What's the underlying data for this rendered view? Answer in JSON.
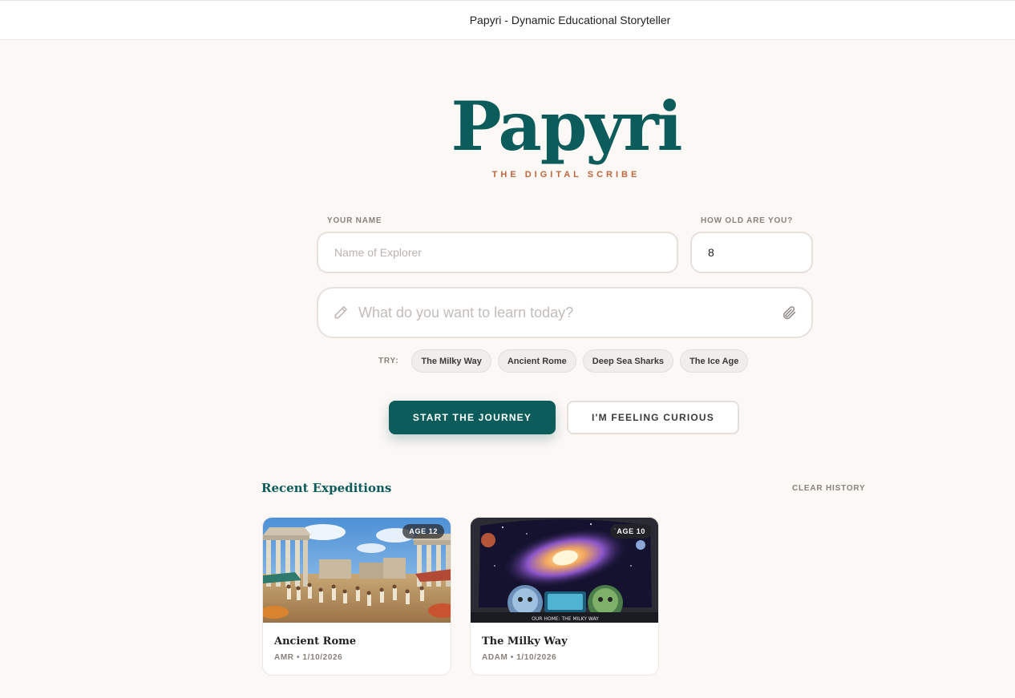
{
  "window": {
    "title": "Papyri - Dynamic Educational Storyteller"
  },
  "brand": {
    "name": "Papyri",
    "tagline": "THE DIGITAL SCRIBE",
    "color": "#0b5c5a",
    "accent": "#c0673f"
  },
  "form": {
    "name_label": "YOUR NAME",
    "name_placeholder": "Name of Explorer",
    "name_value": "",
    "age_label": "HOW OLD ARE YOU?",
    "age_value": "8",
    "topic_placeholder": "What do you want to learn today?",
    "topic_icon": "pencil-icon",
    "attach_icon": "paperclip-icon"
  },
  "suggestions": {
    "label": "TRY:",
    "items": [
      "The Milky Way",
      "Ancient Rome",
      "Deep Sea Sharks",
      "The Ice Age"
    ]
  },
  "actions": {
    "start": "START THE JOURNEY",
    "curious": "I'M FEELING CURIOUS"
  },
  "recent": {
    "title": "Recent Expeditions",
    "clear": "CLEAR HISTORY",
    "cards": [
      {
        "title": "Ancient Rome",
        "age": "AGE 12",
        "meta": "AMR • 1/10/2026",
        "image": "ancient-rome-illustration"
      },
      {
        "title": "The Milky Way",
        "age": "AGE 10",
        "meta": "ADAM • 1/10/2026",
        "image": "milky-way-illustration",
        "image_caption": "OUR HOME: THE MILKY WAY"
      }
    ]
  }
}
